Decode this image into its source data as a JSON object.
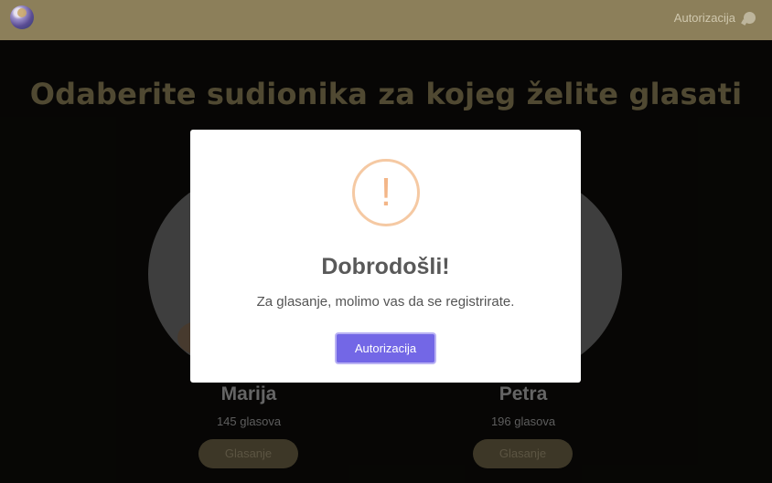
{
  "header": {
    "auth_label": "Autorizacija",
    "logo_icon": "logo-icon",
    "chat_icon": "chat-icon"
  },
  "page": {
    "title": "Odaberite sudionika za kojeg želite glasati"
  },
  "participants": [
    {
      "name": "Marija",
      "votes": "145 glasova",
      "vote_label": "Glasanje"
    },
    {
      "name": "Petra",
      "votes": "196 glasova",
      "vote_label": "Glasanje"
    }
  ],
  "modal": {
    "icon": "warning-icon",
    "icon_glyph": "!",
    "title": "Dobrodošli!",
    "text": "Za glasanje, molimo vas da se registrirate.",
    "button_label": "Autorizacija"
  },
  "colors": {
    "header_bg": "#8c7f5a",
    "title_gold": "#7b704d",
    "modal_button": "#7367e6",
    "warning": "#f5c9a3"
  }
}
